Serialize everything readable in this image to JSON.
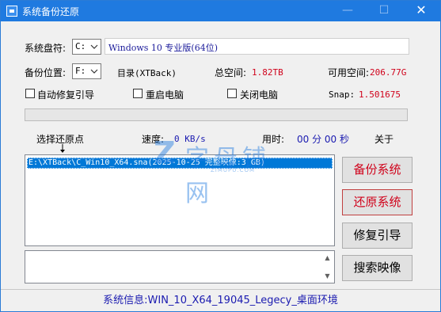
{
  "window": {
    "title": "系统备份还原",
    "minimize_glyph": "—",
    "maximize_glyph": "☐",
    "close_glyph": "✕"
  },
  "system_disk": {
    "label": "系统盘符:",
    "drive": "C:",
    "os_name": "Windows 10 专业版(64位)"
  },
  "backup_location": {
    "label": "备份位置:",
    "drive": "F:",
    "dir_label": "目录(XTBack)"
  },
  "space": {
    "total_label": "总空间:",
    "total_value": "1.82TB",
    "free_label": "可用空间:",
    "free_value": "206.77G"
  },
  "options": {
    "auto_repair": "自动修复引导",
    "reboot": "重启电脑",
    "shutdown": "关闭电脑",
    "snap_label": "Snap:",
    "snap_value": "1.501675"
  },
  "progress": {
    "percent": 0
  },
  "stats": {
    "restore_point_label": "选择还原点",
    "speed_label": "速度:",
    "speed_value": "0 KB/s",
    "elapsed_label": "用时:",
    "elapsed_value": "00 分 00 秒",
    "about_label": "关于"
  },
  "restore_points": [
    {
      "text": "E:\\XTBack\\C_Win10_X64.sna(2025-10-25 完整映像:3 GB)",
      "selected": true
    }
  ],
  "buttons": {
    "backup": "备份系统",
    "restore": "还原系统",
    "repair_boot": "修复引导",
    "search_image": "搜索映像"
  },
  "status": {
    "text": "系统信息:WIN_10_X64_19045_Legecy_桌面环境"
  },
  "watermark": {
    "logo": "Z",
    "cn": "字母铺网",
    "domain": "ZIMUPU.COM"
  },
  "colors": {
    "titlebar": "#1f7ae0",
    "accent_red": "#d0021b",
    "accent_blue": "#1a1ab0",
    "selection": "#0078d7"
  },
  "icons": [
    "app-icon",
    "minimize-icon",
    "maximize-icon",
    "close-icon",
    "dropdown-arrow-icon",
    "down-arrow-icon",
    "scroll-up-icon",
    "scroll-down-icon"
  ]
}
